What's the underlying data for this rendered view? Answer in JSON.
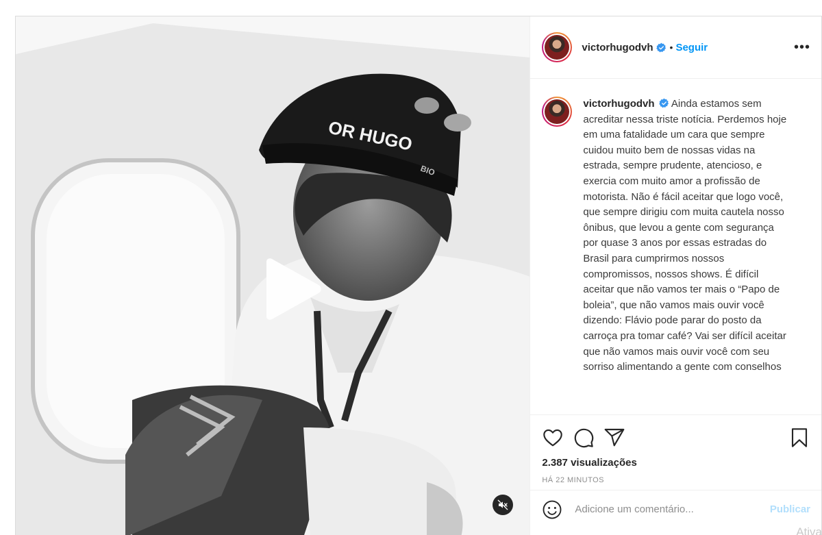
{
  "post": {
    "username": "victorhugodvh",
    "follow_label": "Seguir",
    "dot": "•",
    "more_label": "•••",
    "caption": "Ainda estamos sem acreditar nessa triste notícia. Perdemos hoje em uma fatalidade um cara que sempre cuidou muito bem de nossas vidas na estrada, sempre prudente, atencioso, e exercia com muito amor a profissão de motorista. Não é fácil aceitar que logo você, que sempre dirigiu com muita cautela nosso ônibus, que levou a gente com segurança por quase 3 anos por essas estradas do Brasil para cumprirmos nossos compromissos, nossos shows. É difícil aceitar que não vamos ter mais o “Papo de boleia”, que não vamos mais ouvir você dizendo: Flávio pode parar do posto da carroça pra tomar café? Vai ser difícil aceitar que não vamos mais ouvir você com seu sorriso alimentando a gente com conselhos",
    "views": "2.387 visualizações",
    "time_ago": "HÁ 22 MINUTOS",
    "comment_placeholder": "Adicione um comentário...",
    "publish_label": "Publicar"
  },
  "media": {
    "cap_text": "OR HUGO",
    "cap_side_text": "BIO",
    "icons": [
      "play-icon",
      "mute-icon"
    ]
  },
  "icons": [
    "verified-badge-icon",
    "heart-icon",
    "comment-icon",
    "share-icon",
    "bookmark-icon",
    "emoji-icon"
  ],
  "watermark": "Ativa",
  "colors": {
    "link": "#0095f6",
    "publish_disabled": "#b2dffc",
    "muted": "#8e8e8e"
  }
}
